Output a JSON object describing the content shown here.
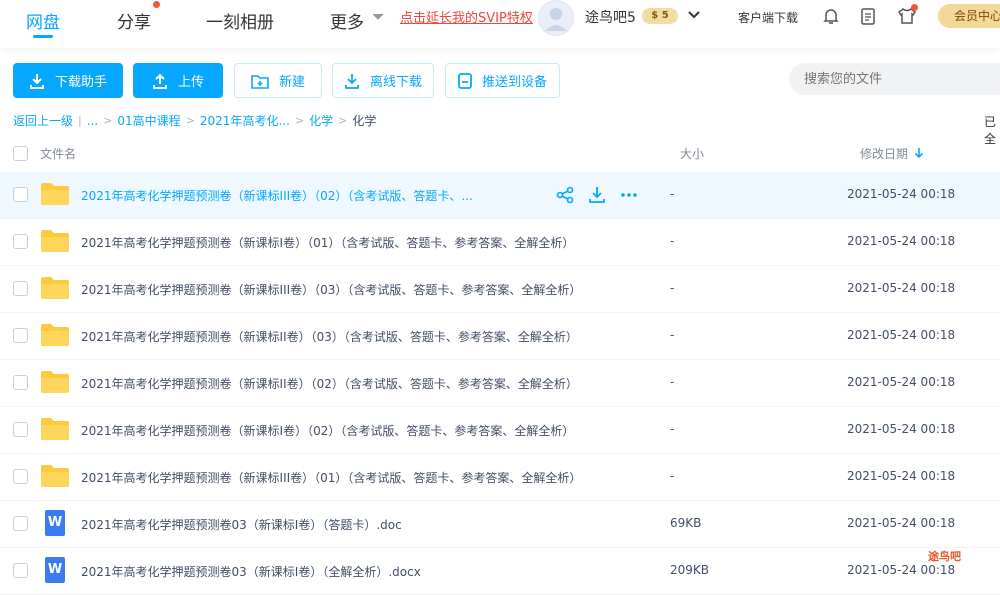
{
  "nav": {
    "items": [
      "网盘",
      "分享",
      "一刻相册",
      "更多"
    ],
    "promo": "点击延长我的SVIP特权",
    "username": "途鸟吧5",
    "svip_badge": "$ 5",
    "client_download": "客户端下载",
    "member_center": "会员中心"
  },
  "toolbar": {
    "download_helper": "下载助手",
    "upload": "上传",
    "new": "新建",
    "offline_download": "离线下载",
    "push_device": "推送到设备",
    "search_placeholder": "搜索您的文件"
  },
  "breadcrumb": {
    "back": "返回上一级",
    "ellipsis": "...",
    "level1": "01高中课程",
    "level2": "2021年高考化...",
    "level3": "化学",
    "current": "化学",
    "loaded_text": "已全"
  },
  "columns": {
    "name": "文件名",
    "size": "大小",
    "modified": "修改日期"
  },
  "files": [
    {
      "name": "2021年高考化学押题预测卷（新课标III卷）（02）（含考试版、答题卡、...",
      "size": "-",
      "date": "2021-05-24 00:18",
      "type": "folder"
    },
    {
      "name": "2021年高考化学押题预测卷（新课标I卷）（01）（含考试版、答题卡、参考答案、全解全析）",
      "size": "-",
      "date": "2021-05-24 00:18",
      "type": "folder"
    },
    {
      "name": "2021年高考化学押题预测卷（新课标III卷）（03）（含考试版、答题卡、参考答案、全解全析）",
      "size": "-",
      "date": "2021-05-24 00:18",
      "type": "folder"
    },
    {
      "name": "2021年高考化学押题预测卷（新课标II卷）（03）（含考试版、答题卡、参考答案、全解全析）",
      "size": "-",
      "date": "2021-05-24 00:18",
      "type": "folder"
    },
    {
      "name": "2021年高考化学押题预测卷（新课标II卷）（02）（含考试版、答题卡、参考答案、全解全析）",
      "size": "-",
      "date": "2021-05-24 00:18",
      "type": "folder"
    },
    {
      "name": "2021年高考化学押题预测卷（新课标I卷）（02）（含考试版、答题卡、参考答案、全解全析）",
      "size": "-",
      "date": "2021-05-24 00:18",
      "type": "folder"
    },
    {
      "name": "2021年高考化学押题预测卷（新课标III卷）（01）（含考试版、答题卡、参考答案、全解全析）",
      "size": "-",
      "date": "2021-05-24 00:18",
      "type": "folder"
    },
    {
      "name": "2021年高考化学押题预测卷03（新课标I卷）（答题卡）.doc",
      "size": "69KB",
      "date": "2021-05-24 00:18",
      "type": "word"
    },
    {
      "name": "2021年高考化学押题预测卷03（新课标I卷）（全解全析）.docx",
      "size": "209KB",
      "date": "2021-05-24 00:18",
      "type": "word"
    }
  ],
  "watermark": "途鸟吧"
}
